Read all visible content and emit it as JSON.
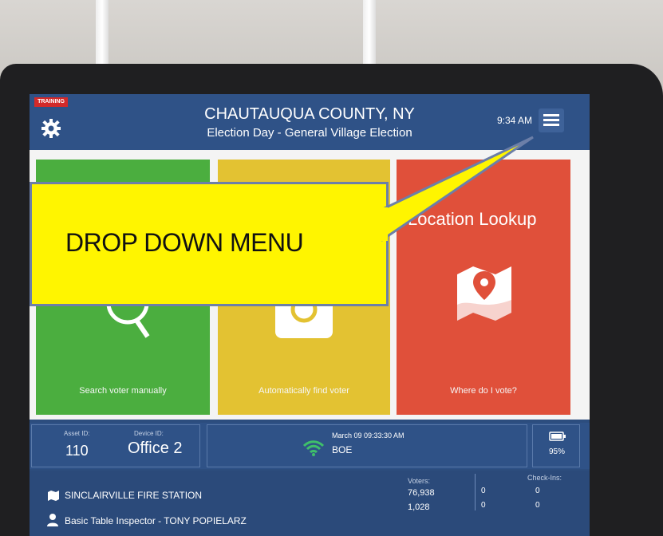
{
  "header": {
    "training_badge": "TRAINING",
    "county": "CHAUTAUQUA COUNTY, NY",
    "election": "Election Day - General Village Election",
    "time": "9:34 AM"
  },
  "tiles": [
    {
      "caption": "Search voter manually",
      "color": "#4bae3f"
    },
    {
      "caption": "Automatically find voter",
      "color": "#e3c232"
    },
    {
      "title": "Location Lookup",
      "caption": "Where do I vote?",
      "color": "#e0503a"
    }
  ],
  "status": {
    "asset_label": "Asset ID:",
    "asset_value": "110",
    "device_label": "Device ID:",
    "device_value": "Office 2",
    "datetime": "March 09  09:33:30 AM",
    "connection": "BOE",
    "battery": "95%"
  },
  "bottom": {
    "location": "SINCLAIRVILLE FIRE STATION",
    "inspector": "Basic Table Inspector - TONY POPIELARZ",
    "voters_label": "Voters:",
    "voters_total": "76,938",
    "voters_local": "1,028",
    "checkins_label": "Check-Ins:",
    "ci_a": "0",
    "ci_b": "0",
    "ci_c": "0",
    "ci_d": "0"
  },
  "callout": {
    "text": "DROP DOWN MENU"
  },
  "icons": [
    "gear-icon",
    "hamburger-menu-icon",
    "search-icon",
    "camera-icon",
    "map-pin-icon",
    "wifi-icon",
    "battery-icon",
    "location-icon",
    "person-icon"
  ]
}
